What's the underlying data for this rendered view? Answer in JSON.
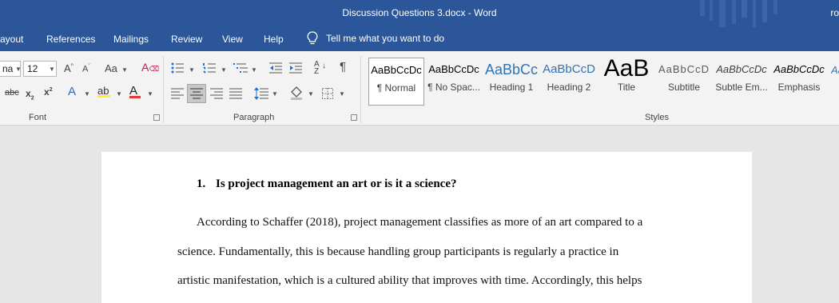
{
  "window": {
    "title": "Discussion Questions 3.docx  -  Word",
    "user_partial": "ro"
  },
  "menu": {
    "items": [
      "ayout",
      "References",
      "Mailings",
      "Review",
      "View",
      "Help"
    ],
    "tellme": "Tell me what you want to do"
  },
  "ribbon": {
    "font": {
      "name": "na",
      "size": "12",
      "group_label": "Font",
      "change_case": "Aa"
    },
    "paragraph": {
      "group_label": "Paragraph"
    },
    "styles": {
      "group_label": "Styles",
      "tiles": [
        {
          "preview": "AaBbCcDc",
          "label": "¶ Normal",
          "color": "#000000"
        },
        {
          "preview": "AaBbCcDc",
          "label": "¶ No Spac...",
          "color": "#000000"
        },
        {
          "preview": "AaBbCc",
          "label": "Heading 1",
          "color": "#2e74b5"
        },
        {
          "preview": "AaBbCcD",
          "label": "Heading 2",
          "color": "#2e74b5"
        },
        {
          "preview": "AaB",
          "label": "Title",
          "color": "#000000"
        },
        {
          "preview": "AaBbCcD",
          "label": "Subtitle",
          "color": "#5a5a5a"
        },
        {
          "preview": "AaBbCcDc",
          "label": "Subtle Em...",
          "color": "#404040"
        },
        {
          "preview": "AaBbCcDc",
          "label": "Emphasis",
          "color": "#000000"
        }
      ]
    }
  },
  "document": {
    "heading_number": "1.",
    "heading": "Is project management an art or is it a science?",
    "lines": [
      "According to Schaffer (2018), project management classifies as more of an art compared to a",
      "science. Fundamentally, this is because handling group participants is regularly a practice in",
      "artistic manifestation, which is a cultured ability that improves with time. Accordingly, this helps"
    ]
  },
  "colors": {
    "accent": "#2b579a",
    "ribbon": "#f3f3f3",
    "canvas": "#e6e6e6"
  }
}
